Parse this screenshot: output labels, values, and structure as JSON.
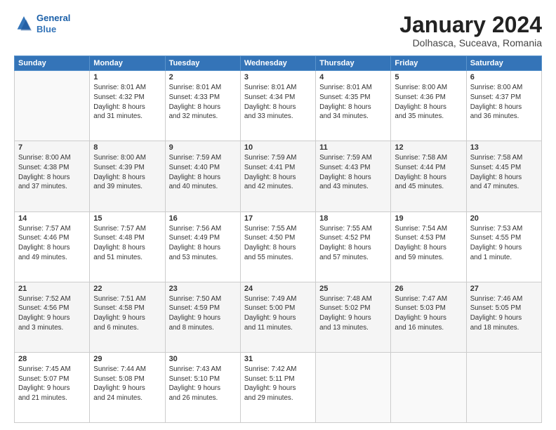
{
  "logo": {
    "line1": "General",
    "line2": "Blue"
  },
  "title": "January 2024",
  "subtitle": "Dolhasca, Suceava, Romania",
  "weekdays": [
    "Sunday",
    "Monday",
    "Tuesday",
    "Wednesday",
    "Thursday",
    "Friday",
    "Saturday"
  ],
  "weeks": [
    [
      {
        "day": "",
        "info": ""
      },
      {
        "day": "1",
        "info": "Sunrise: 8:01 AM\nSunset: 4:32 PM\nDaylight: 8 hours\nand 31 minutes."
      },
      {
        "day": "2",
        "info": "Sunrise: 8:01 AM\nSunset: 4:33 PM\nDaylight: 8 hours\nand 32 minutes."
      },
      {
        "day": "3",
        "info": "Sunrise: 8:01 AM\nSunset: 4:34 PM\nDaylight: 8 hours\nand 33 minutes."
      },
      {
        "day": "4",
        "info": "Sunrise: 8:01 AM\nSunset: 4:35 PM\nDaylight: 8 hours\nand 34 minutes."
      },
      {
        "day": "5",
        "info": "Sunrise: 8:00 AM\nSunset: 4:36 PM\nDaylight: 8 hours\nand 35 minutes."
      },
      {
        "day": "6",
        "info": "Sunrise: 8:00 AM\nSunset: 4:37 PM\nDaylight: 8 hours\nand 36 minutes."
      }
    ],
    [
      {
        "day": "7",
        "info": "Sunrise: 8:00 AM\nSunset: 4:38 PM\nDaylight: 8 hours\nand 37 minutes."
      },
      {
        "day": "8",
        "info": "Sunrise: 8:00 AM\nSunset: 4:39 PM\nDaylight: 8 hours\nand 39 minutes."
      },
      {
        "day": "9",
        "info": "Sunrise: 7:59 AM\nSunset: 4:40 PM\nDaylight: 8 hours\nand 40 minutes."
      },
      {
        "day": "10",
        "info": "Sunrise: 7:59 AM\nSunset: 4:41 PM\nDaylight: 8 hours\nand 42 minutes."
      },
      {
        "day": "11",
        "info": "Sunrise: 7:59 AM\nSunset: 4:43 PM\nDaylight: 8 hours\nand 43 minutes."
      },
      {
        "day": "12",
        "info": "Sunrise: 7:58 AM\nSunset: 4:44 PM\nDaylight: 8 hours\nand 45 minutes."
      },
      {
        "day": "13",
        "info": "Sunrise: 7:58 AM\nSunset: 4:45 PM\nDaylight: 8 hours\nand 47 minutes."
      }
    ],
    [
      {
        "day": "14",
        "info": "Sunrise: 7:57 AM\nSunset: 4:46 PM\nDaylight: 8 hours\nand 49 minutes."
      },
      {
        "day": "15",
        "info": "Sunrise: 7:57 AM\nSunset: 4:48 PM\nDaylight: 8 hours\nand 51 minutes."
      },
      {
        "day": "16",
        "info": "Sunrise: 7:56 AM\nSunset: 4:49 PM\nDaylight: 8 hours\nand 53 minutes."
      },
      {
        "day": "17",
        "info": "Sunrise: 7:55 AM\nSunset: 4:50 PM\nDaylight: 8 hours\nand 55 minutes."
      },
      {
        "day": "18",
        "info": "Sunrise: 7:55 AM\nSunset: 4:52 PM\nDaylight: 8 hours\nand 57 minutes."
      },
      {
        "day": "19",
        "info": "Sunrise: 7:54 AM\nSunset: 4:53 PM\nDaylight: 8 hours\nand 59 minutes."
      },
      {
        "day": "20",
        "info": "Sunrise: 7:53 AM\nSunset: 4:55 PM\nDaylight: 9 hours\nand 1 minute."
      }
    ],
    [
      {
        "day": "21",
        "info": "Sunrise: 7:52 AM\nSunset: 4:56 PM\nDaylight: 9 hours\nand 3 minutes."
      },
      {
        "day": "22",
        "info": "Sunrise: 7:51 AM\nSunset: 4:58 PM\nDaylight: 9 hours\nand 6 minutes."
      },
      {
        "day": "23",
        "info": "Sunrise: 7:50 AM\nSunset: 4:59 PM\nDaylight: 9 hours\nand 8 minutes."
      },
      {
        "day": "24",
        "info": "Sunrise: 7:49 AM\nSunset: 5:00 PM\nDaylight: 9 hours\nand 11 minutes."
      },
      {
        "day": "25",
        "info": "Sunrise: 7:48 AM\nSunset: 5:02 PM\nDaylight: 9 hours\nand 13 minutes."
      },
      {
        "day": "26",
        "info": "Sunrise: 7:47 AM\nSunset: 5:03 PM\nDaylight: 9 hours\nand 16 minutes."
      },
      {
        "day": "27",
        "info": "Sunrise: 7:46 AM\nSunset: 5:05 PM\nDaylight: 9 hours\nand 18 minutes."
      }
    ],
    [
      {
        "day": "28",
        "info": "Sunrise: 7:45 AM\nSunset: 5:07 PM\nDaylight: 9 hours\nand 21 minutes."
      },
      {
        "day": "29",
        "info": "Sunrise: 7:44 AM\nSunset: 5:08 PM\nDaylight: 9 hours\nand 24 minutes."
      },
      {
        "day": "30",
        "info": "Sunrise: 7:43 AM\nSunset: 5:10 PM\nDaylight: 9 hours\nand 26 minutes."
      },
      {
        "day": "31",
        "info": "Sunrise: 7:42 AM\nSunset: 5:11 PM\nDaylight: 9 hours\nand 29 minutes."
      },
      {
        "day": "",
        "info": ""
      },
      {
        "day": "",
        "info": ""
      },
      {
        "day": "",
        "info": ""
      }
    ]
  ]
}
